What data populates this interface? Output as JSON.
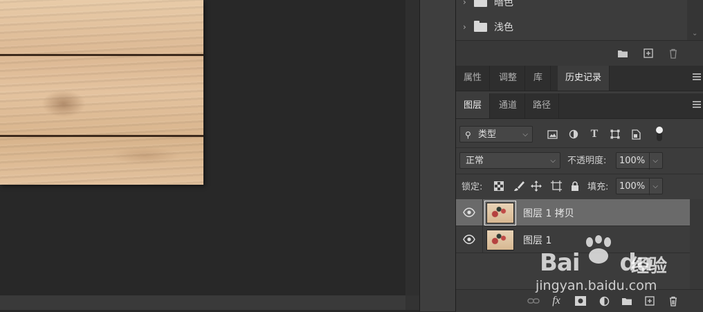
{
  "swatches_panel": {
    "folders": [
      {
        "label": "暗色"
      },
      {
        "label": "浅色"
      }
    ]
  },
  "panel_tabs_top": {
    "tabs": [
      {
        "label": "属性"
      },
      {
        "label": "调整"
      },
      {
        "label": "库"
      },
      {
        "label": "历史记录",
        "active": true
      }
    ]
  },
  "panel_tabs_layers": {
    "tabs": [
      {
        "label": "图层",
        "active": true
      },
      {
        "label": "通道"
      },
      {
        "label": "路径"
      }
    ]
  },
  "layers": {
    "filter_kind": "类型",
    "blend_mode": "正常",
    "opacity_label": "不透明度:",
    "opacity_value": "100%",
    "lock_label": "锁定:",
    "fill_label": "填充:",
    "fill_value": "100%",
    "items": [
      {
        "name": "图层 1 拷贝",
        "selected": true
      },
      {
        "name": "图层 1",
        "selected": false
      }
    ]
  },
  "watermark": {
    "brand": "Bai",
    "brand_du": "du",
    "brand_cn": "经验",
    "url": "jingyan.baidu.com"
  },
  "colors": {
    "canvas_bg": "#282828",
    "panel_bg": "#3c3c3c",
    "selected_row": "#6a6a6a"
  }
}
